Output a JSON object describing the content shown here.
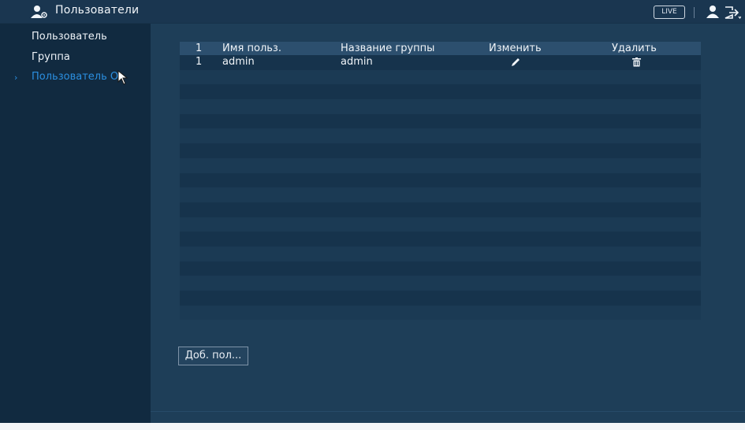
{
  "header": {
    "title": "Пользователи",
    "live_label": "LIVE"
  },
  "sidebar": {
    "items": [
      {
        "label": "Пользователь"
      },
      {
        "label": "Группа"
      },
      {
        "label": "Пользователь O",
        "active": true
      }
    ]
  },
  "table": {
    "columns": [
      "1",
      "Имя польз.",
      "Название группы",
      "Изменить",
      "Удалить"
    ],
    "rows": [
      {
        "num": "1",
        "user": "admin",
        "group": "admin"
      }
    ],
    "icons": {
      "edit": "pencil-icon",
      "delete": "trash-icon"
    }
  },
  "actions": {
    "add_user_label": "Доб. пол..."
  },
  "colors": {
    "accent": "#2b8fe0",
    "sidebar_bg": "#112a40",
    "main_bg": "#1e3e58",
    "header_row": "#2c4f6e"
  }
}
